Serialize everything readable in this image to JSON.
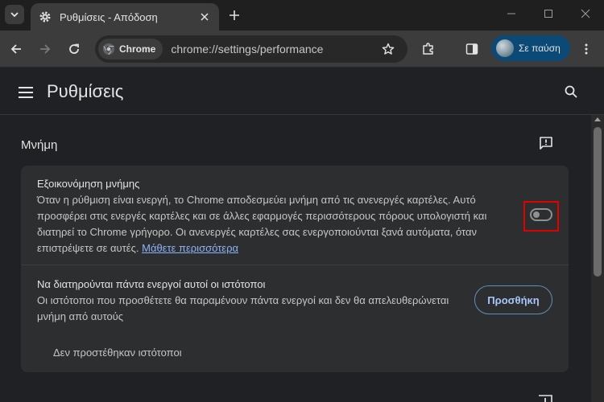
{
  "tab": {
    "title": "Ρυθμίσεις - Απόδοση"
  },
  "omnibox": {
    "chip_label": "Chrome",
    "url": "chrome://settings/performance"
  },
  "profile": {
    "label": "Σε παύση"
  },
  "settings": {
    "title": "Ρυθμίσεις"
  },
  "memory": {
    "section_title": "Μνήμη",
    "saver_title": "Εξοικονόμηση μνήμης",
    "saver_desc": "Όταν η ρύθμιση είναι ενεργή, το Chrome αποδεσμεύει μνήμη από τις ανενεργές καρτέλες. Αυτό προσφέρει στις ενεργές καρτέλες και σε άλλες εφαρμογές περισσότερους πόρους υπολογιστή και διατηρεί το Chrome γρήγορο. Οι ανενεργές καρτέλες σας ενεργοποιούνται ξανά αυτόματα, όταν επιστρέψετε σε αυτές.",
    "learn_more": "Μάθετε περισσότερα",
    "saver_enabled": false,
    "sites_title": "Να διατηρούνται πάντα ενεργοί αυτοί οι ιστότοποι",
    "sites_desc": "Οι ιστότοποι που προσθέτετε θα παραμένουν πάντα ενεργοί και δεν θα απελευθερώνεται μνήμη από αυτούς",
    "add_button": "Προσθήκη",
    "empty_note": "Δεν προστέθηκαν ιστότοποι"
  },
  "colors": {
    "accent": "#a8c7fa",
    "link": "#8ab4f8",
    "highlight": "#e00000",
    "profile_bg": "#0b4a76"
  }
}
